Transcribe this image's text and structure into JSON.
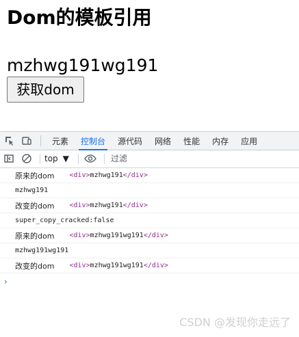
{
  "page": {
    "title": "Dom的模板引用",
    "dom_text": "mzhwg191wg191",
    "button_label": "获取dom"
  },
  "devtools": {
    "tabs": [
      {
        "label": "元素",
        "active": false
      },
      {
        "label": "控制台",
        "active": true
      },
      {
        "label": "源代码",
        "active": false
      },
      {
        "label": "网络",
        "active": false
      },
      {
        "label": "性能",
        "active": false
      },
      {
        "label": "内存",
        "active": false
      },
      {
        "label": "应用",
        "active": false
      }
    ],
    "toolbar": {
      "context": "top",
      "filter_placeholder": "过滤"
    },
    "console": [
      {
        "label": "原来的dom",
        "tag_open": "<div>",
        "text": "mzhwg191",
        "tag_close": "</div>"
      },
      {
        "plain": "mzhwg191"
      },
      {
        "label": "改变的dom",
        "tag_open": "<div>",
        "text": "mzhwg191",
        "tag_close": "</div>"
      },
      {
        "plain": "super_copy_cracked:false"
      },
      {
        "label": "原来的dom",
        "tag_open": "<div>",
        "text": "mzhwg191wg191",
        "tag_close": "</div>"
      },
      {
        "plain": "mzhwg191wg191"
      },
      {
        "label": "改变的dom",
        "tag_open": "<div>",
        "text": "mzhwg191wg191",
        "tag_close": "</div>"
      }
    ],
    "prompt_symbol": "›"
  },
  "watermark": "CSDN @发现你走远了",
  "icons": {
    "inspect": "inspect-element-icon",
    "device": "device-toolbar-icon",
    "sidebar": "console-sidebar-icon",
    "clear": "clear-console-icon",
    "eye": "live-expression-icon",
    "dropdown": "chevron-down-icon"
  },
  "colors": {
    "active_tab": "#1a73e8",
    "tag_color": "#8e2c8e",
    "watermark": "#d0d0d0"
  }
}
